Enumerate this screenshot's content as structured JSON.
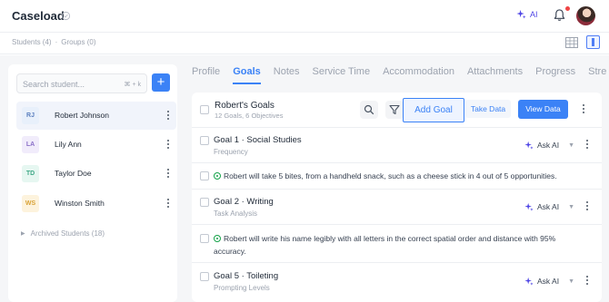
{
  "app": {
    "title": "Caseload",
    "ai_label": "AI"
  },
  "breadcrumbs": {
    "students": "Students (4)",
    "separator": "·",
    "groups": "Groups (0)"
  },
  "sidebar": {
    "search_placeholder": "Search student...",
    "search_shortcut": "⌘ + k",
    "add_label": "+",
    "students": [
      {
        "initials": "RJ",
        "name": "Robert Johnson",
        "selected": true,
        "bg": "#e8f0fb",
        "fg": "#5b7fbf"
      },
      {
        "initials": "LA",
        "name": "Lily Ann",
        "selected": false,
        "bg": "#f1ecfb",
        "fg": "#8a6fc7"
      },
      {
        "initials": "TD",
        "name": "Taylor Doe",
        "selected": false,
        "bg": "#e6f7f1",
        "fg": "#3fa886"
      },
      {
        "initials": "WS",
        "name": "Winston Smith",
        "selected": false,
        "bg": "#fdf3dd",
        "fg": "#d8a236"
      }
    ],
    "archived_label": "Archived Students (18)"
  },
  "tabs": [
    "Profile",
    "Goals",
    "Notes",
    "Service Time",
    "Accommodation",
    "Attachments",
    "Progress",
    "Stre"
  ],
  "active_tab": "Goals",
  "goals_header": {
    "title": "Robert's Goals",
    "subtitle": "12 Goals, 6 Objectives",
    "add_goal": "Add Goal",
    "take_data": "Take Data",
    "view_data": "View Data"
  },
  "goals": [
    {
      "title": "Goal 1 · Social Studies",
      "subtitle": "Frequency",
      "ask_ai": "Ask AI",
      "objective": "Robert will take 5 bites, from a handheld snack, such as a cheese stick in 4 out of 5 opportunities."
    },
    {
      "title": "Goal 2 · Writing",
      "subtitle": "Task Analysis",
      "ask_ai": "Ask AI",
      "objective": "Robert will write his name legibly with all letters in the correct spatial order and distance with 95% accuracy."
    },
    {
      "title": "Goal 5 · Toileting",
      "subtitle": "Prompting Levels",
      "ask_ai": "Ask AI"
    }
  ],
  "colors": {
    "accent": "#3b82f6",
    "ai": "#4f46e5",
    "notification": "#ef4444"
  }
}
